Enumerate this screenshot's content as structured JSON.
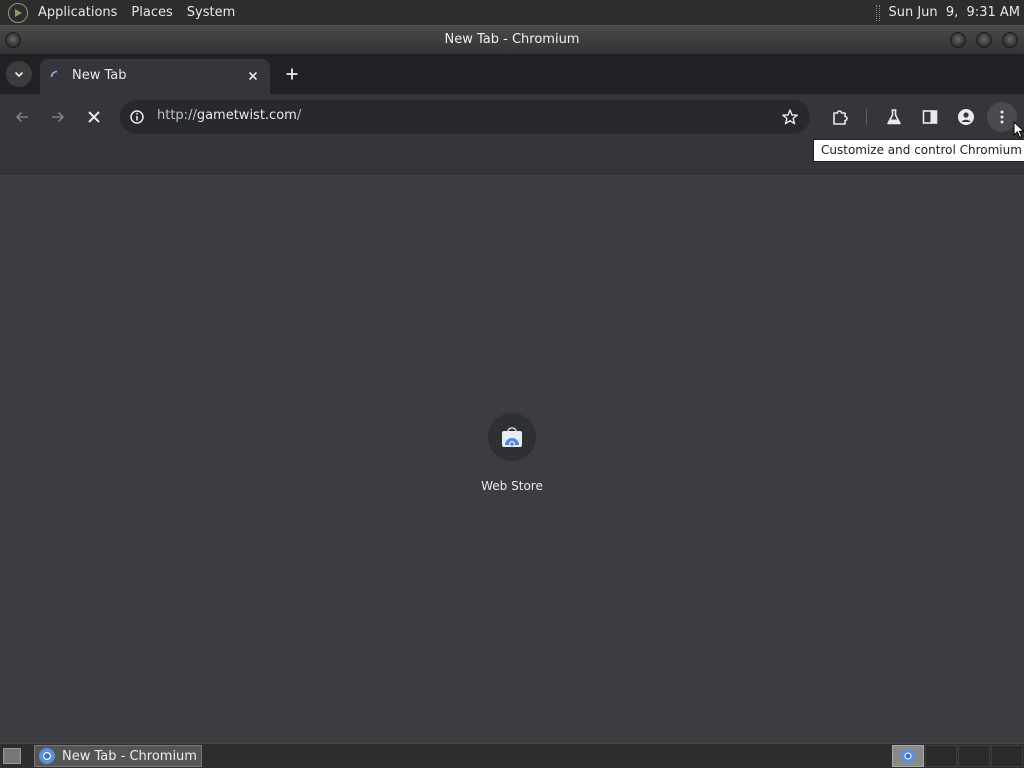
{
  "top_panel": {
    "menus": [
      "Applications",
      "Places",
      "System"
    ],
    "clock": "Sun Jun  9,  9:31 AM"
  },
  "window": {
    "title": "New Tab - Chromium"
  },
  "browser": {
    "tab": {
      "title": "New Tab",
      "loading": true
    },
    "omnibox": {
      "scheme": "http://",
      "host": "gametwist.com",
      "path": "/"
    },
    "tooltip": "Customize and control Chromium",
    "icons": {
      "back": "back-arrow-icon",
      "forward": "forward-arrow-icon",
      "stop": "stop-icon",
      "info": "info-icon",
      "bookmark": "star-icon",
      "extensions": "puzzle-icon",
      "labs": "flask-icon",
      "side_panel": "side-panel-icon",
      "profile": "person-icon",
      "menu": "kebab-menu-icon"
    }
  },
  "new_tab_page": {
    "shortcuts": [
      {
        "label": "Web Store",
        "icon": "web-store-icon"
      }
    ]
  },
  "taskbar": {
    "tasks": [
      {
        "label": "New Tab - Chromium",
        "icon": "chromium-icon"
      }
    ],
    "workspaces": 4,
    "active_workspace": 1
  },
  "colors": {
    "page_bg": "#3d3d41",
    "toolbar_bg": "#35363a",
    "tabstrip_bg": "#202124",
    "accent_blue": "#4f86e8"
  }
}
